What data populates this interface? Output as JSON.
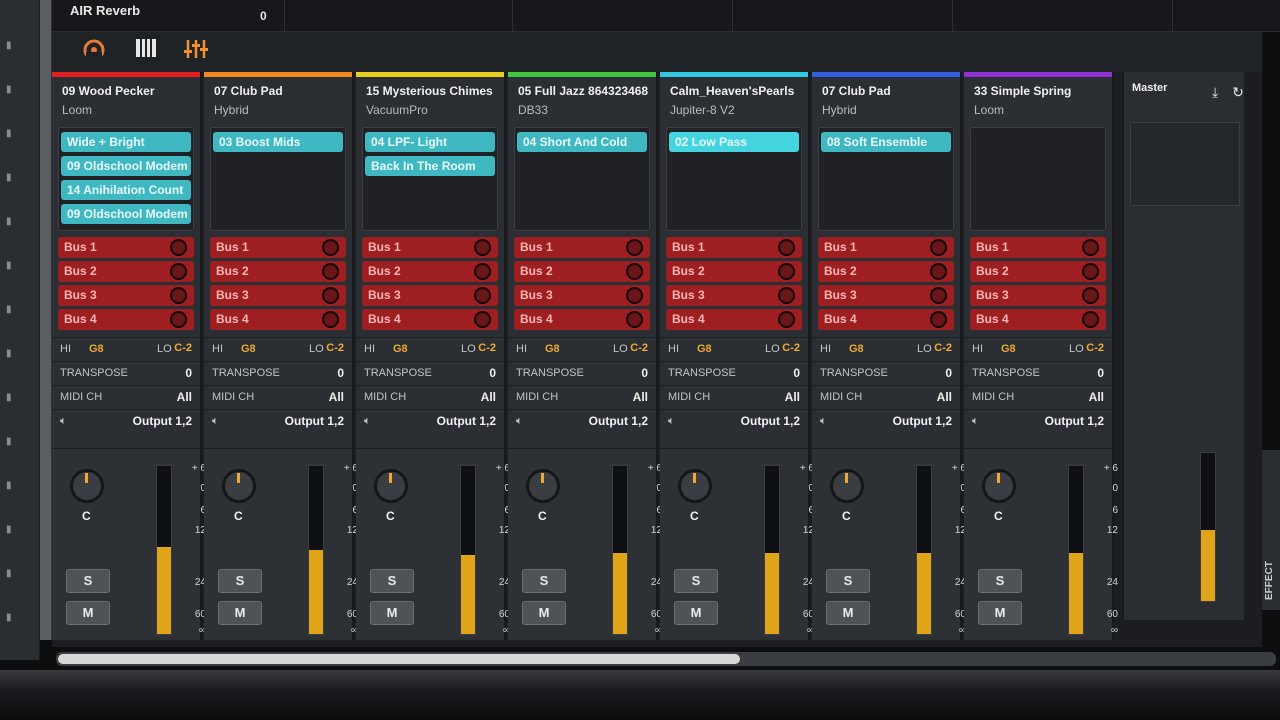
{
  "topbar": {
    "plugin_name": "AIR Reverb",
    "plugin_value": "0"
  },
  "toolbar": {
    "icons": [
      "monitor-icon",
      "keyboard-icon",
      "mixer-sliders-icon"
    ]
  },
  "channels": [
    {
      "name": "09 Wood Pecker",
      "instrument": "Loom",
      "color": "#e02020",
      "presets": [
        "Wide + Bright",
        "09 Oldschool Modem",
        "14 Anihilation Count",
        "09 Oldschool Modem"
      ],
      "hi_label": "HI",
      "hi": "G8",
      "lo_label": "LO",
      "lo": "C-2",
      "transpose_label": "TRANSPOSE",
      "transpose": "0",
      "midi_label": "MIDI CH",
      "midi": "All",
      "output": "Output 1,2",
      "pan": "C",
      "solo": "S",
      "mute": "M",
      "level": 0.52
    },
    {
      "name": "07 Club Pad",
      "instrument": "Hybrid",
      "color": "#f08a20",
      "presets": [
        "03 Boost Mids"
      ],
      "hi_label": "HI",
      "hi": "G8",
      "lo_label": "LO",
      "lo": "C-2",
      "transpose_label": "TRANSPOSE",
      "transpose": "0",
      "midi_label": "MIDI CH",
      "midi": "All",
      "output": "Output 1,2",
      "pan": "C",
      "solo": "S",
      "mute": "M",
      "level": 0.5
    },
    {
      "name": "15 Mysterious Chimes",
      "instrument": "VacuumPro",
      "color": "#e8d020",
      "presets": [
        "04 LPF- Light",
        "Back In The Room"
      ],
      "hi_label": "HI",
      "hi": "G8",
      "lo_label": "LO",
      "lo": "C-2",
      "transpose_label": "TRANSPOSE",
      "transpose": "0",
      "midi_label": "MIDI CH",
      "midi": "All",
      "output": "Output 1,2",
      "pan": "C",
      "solo": "S",
      "mute": "M",
      "level": 0.47
    },
    {
      "name": "05 Full Jazz 864323468",
      "instrument": "DB33",
      "color": "#40c840",
      "presets": [
        "04 Short And Cold"
      ],
      "hi_label": "HI",
      "hi": "G8",
      "lo_label": "LO",
      "lo": "C-2",
      "transpose_label": "TRANSPOSE",
      "transpose": "0",
      "midi_label": "MIDI CH",
      "midi": "All",
      "output": "Output 1,2",
      "pan": "C",
      "solo": "S",
      "mute": "M",
      "level": 0.48
    },
    {
      "name": "Calm_Heaven'sPearls",
      "instrument": "Jupiter-8 V2",
      "color": "#30c8e0",
      "presets": [
        "02 Low Pass"
      ],
      "hi_label": "HI",
      "hi": "G8",
      "lo_label": "LO",
      "lo": "C-2",
      "transpose_label": "TRANSPOSE",
      "transpose": "0",
      "midi_label": "MIDI CH",
      "midi": "All",
      "output": "Output 1,2",
      "pan": "C",
      "solo": "S",
      "mute": "M",
      "level": 0.48
    },
    {
      "name": "07 Club Pad",
      "instrument": "Hybrid",
      "color": "#3060e0",
      "presets": [
        "08 Soft Ensemble"
      ],
      "hi_label": "HI",
      "hi": "G8",
      "lo_label": "LO",
      "lo": "C-2",
      "transpose_label": "TRANSPOSE",
      "transpose": "0",
      "midi_label": "MIDI CH",
      "midi": "All",
      "output": "Output 1,2",
      "pan": "C",
      "solo": "S",
      "mute": "M",
      "level": 0.48
    },
    {
      "name": "33 Simple Spring",
      "instrument": "Loom",
      "color": "#9030d0",
      "presets": [],
      "hi_label": "HI",
      "hi": "G8",
      "lo_label": "LO",
      "lo": "C-2",
      "transpose_label": "TRANSPOSE",
      "transpose": "0",
      "midi_label": "MIDI CH",
      "midi": "All",
      "output": "Output 1,2",
      "pan": "C",
      "solo": "S",
      "mute": "M",
      "level": 0.48
    }
  ],
  "bus_labels": [
    "Bus 1",
    "Bus 2",
    "Bus 3",
    "Bus 4"
  ],
  "meter_scale": [
    "+ 6",
    "0",
    "6",
    "12",
    "24",
    "60",
    "∞"
  ],
  "master": {
    "name": "Master"
  },
  "side_tab": {
    "label": "EFFECT"
  },
  "colors": {
    "accent": "#f0a830",
    "preset": "#3fb8c2",
    "bus": "#9e1f22",
    "meter": "#e0a418"
  }
}
